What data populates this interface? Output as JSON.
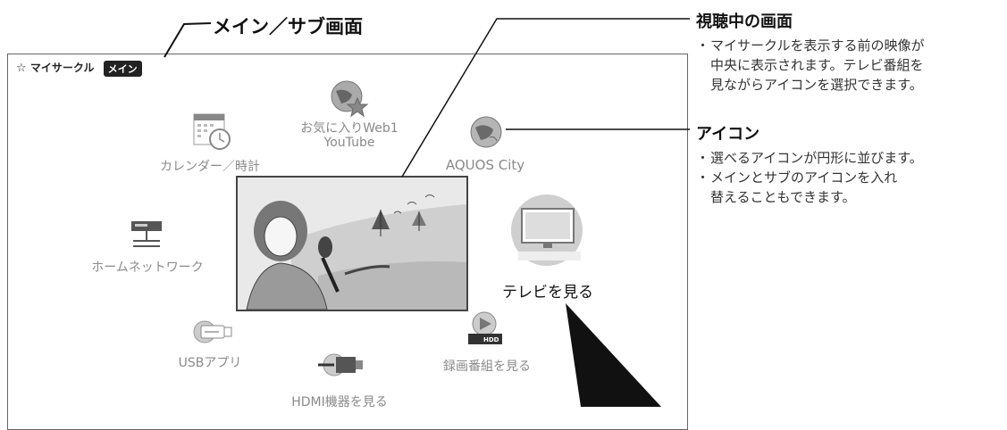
{
  "header_callout": {
    "label": "メイン／サブ画面"
  },
  "menu": {
    "title": "マイサークル",
    "mode_badge": "メイン"
  },
  "icons": [
    {
      "id": "calendar",
      "label": "カレンダー／時計",
      "icon": "calendar-icon"
    },
    {
      "id": "favorite",
      "label": "お気に入りWeb1\nYouTube",
      "icon": "globe-star-icon"
    },
    {
      "id": "aquos",
      "label": "AQUOS City",
      "icon": "globe-icon"
    },
    {
      "id": "network",
      "label": "ホームネットワーク",
      "icon": "network-icon"
    },
    {
      "id": "tv",
      "label": "テレビを見る",
      "icon": "tv-icon",
      "selected": true
    },
    {
      "id": "usb",
      "label": "USBアプリ",
      "icon": "usb-icon"
    },
    {
      "id": "record",
      "label": "録画番組を見る",
      "icon": "hdd-play-icon",
      "hdd_text": "HDD"
    },
    {
      "id": "hdmi",
      "label": "HDMI機器を見る",
      "icon": "hdmi-icon"
    }
  ],
  "callouts": {
    "viewing": {
      "title": "視聴中の画面",
      "bullets": [
        "マイサークルを表示する前の映像が中央に表示されます。テレビ番組を見ながらアイコンを選択できます。"
      ],
      "bullet_lines": [
        "マイサークルを表示する前の映像が",
        "中央に表示されます。テレビ番組を",
        "見ながらアイコンを選択できます。"
      ]
    },
    "icons": {
      "title": "アイコン",
      "bullet1_lines": [
        "選べるアイコンが円形に並びます。"
      ],
      "bullet2_lines": [
        "メインとサブのアイコンを入れ",
        "替えることもできます。"
      ]
    }
  },
  "bullet_mark": "・"
}
